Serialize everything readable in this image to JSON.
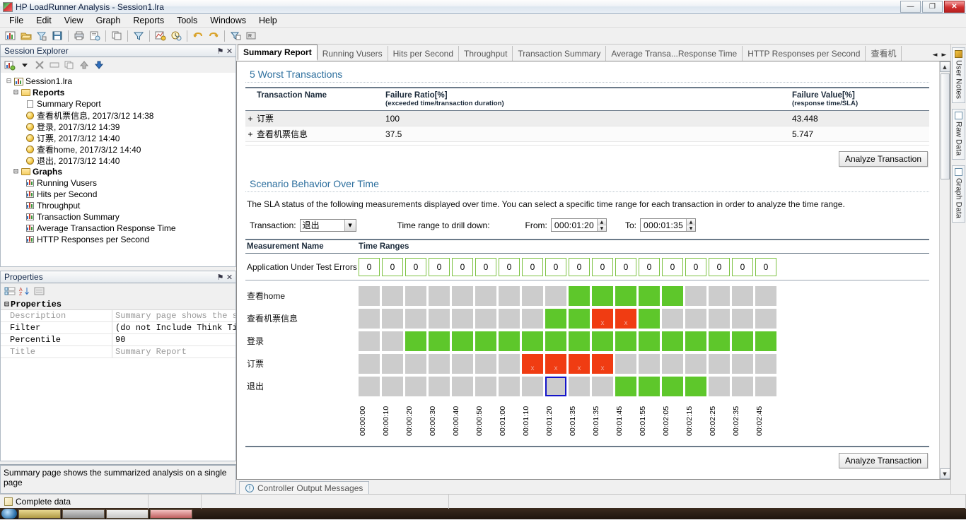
{
  "window": {
    "title": "HP LoadRunner Analysis - Session1.lra",
    "minimize_label": "—",
    "restore_label": "❐",
    "close_label": "✕"
  },
  "menubar": {
    "items": [
      "File",
      "Edit",
      "View",
      "Graph",
      "Reports",
      "Tools",
      "Windows",
      "Help"
    ]
  },
  "toolbar": {
    "buttons": [
      "new-analysis-icon",
      "open-session-icon",
      "set-filter-icon",
      "save-icon",
      "print-icon",
      "report-icon",
      "copy-graph-icon",
      "filter-icon",
      "merge-graphs-icon",
      "auto-correlate-icon",
      "undo-icon",
      "redo-icon",
      "crossresult-icon",
      "raw-data-icon"
    ]
  },
  "session_explorer": {
    "title": "Session Explorer",
    "pin_label": "⚑",
    "close_label": "✕",
    "toolbar": [
      "add-graph-icon",
      "dropdown-icon",
      "delete-icon",
      "rename-icon",
      "duplicate-icon",
      "move-up-icon",
      "move-down-icon"
    ],
    "root": "Session1.lra",
    "groups": [
      {
        "label": "Reports",
        "items": [
          {
            "label": "Summary Report",
            "icon": "document-icon"
          },
          {
            "label": "查看机票信息, 2017/3/12 14:38",
            "icon": "clock-icon"
          },
          {
            "label": "登录, 2017/3/12 14:39",
            "icon": "clock-icon"
          },
          {
            "label": "订票, 2017/3/12 14:40",
            "icon": "clock-icon"
          },
          {
            "label": "查看home, 2017/3/12 14:40",
            "icon": "clock-icon"
          },
          {
            "label": "退出, 2017/3/12 14:40",
            "icon": "clock-icon"
          }
        ]
      },
      {
        "label": "Graphs",
        "items": [
          {
            "label": "Running Vusers",
            "icon": "chart-icon"
          },
          {
            "label": "Hits per Second",
            "icon": "chart-icon"
          },
          {
            "label": "Throughput",
            "icon": "chart-icon"
          },
          {
            "label": "Transaction Summary",
            "icon": "chart-icon"
          },
          {
            "label": "Average Transaction Response Time",
            "icon": "chart-icon"
          },
          {
            "label": "HTTP Responses per Second",
            "icon": "chart-icon"
          }
        ]
      }
    ]
  },
  "properties_panel": {
    "title": "Properties",
    "pin_label": "⚑",
    "close_label": "✕",
    "toolbar": [
      "categorized-icon",
      "sort-alpha-icon",
      "property-pages-icon"
    ],
    "group_label": "Properties",
    "group_twist": "⊟",
    "rows": [
      {
        "key": "Description",
        "value": "Summary page shows the summa",
        "dim": true
      },
      {
        "key": "Filter",
        "value": "(do not Include Think Time)",
        "dim": false
      },
      {
        "key": "Percentile",
        "value": "90",
        "dim": false
      },
      {
        "key": "Title",
        "value": "Summary Report",
        "dim": true
      }
    ],
    "description_text": "Summary page shows the summarized analysis on a single page"
  },
  "tabs": {
    "items": [
      {
        "label": "Summary Report",
        "active": true
      },
      {
        "label": "Running Vusers",
        "active": false
      },
      {
        "label": "Hits per Second",
        "active": false
      },
      {
        "label": "Throughput",
        "active": false
      },
      {
        "label": "Transaction Summary",
        "active": false
      },
      {
        "label": "Average Transa...Response Time",
        "active": false
      },
      {
        "label": "HTTP Responses per Second",
        "active": false
      },
      {
        "label": "查看机",
        "active": false
      }
    ],
    "nav_prev": "◄",
    "nav_next": "►"
  },
  "report": {
    "worst_transactions": {
      "title": "5 Worst Transactions",
      "columns": {
        "expander": "+",
        "name": "Transaction Name",
        "ratio_main": "Failure Ratio[%]",
        "ratio_sub": "(exceeded time/transaction duration)",
        "value_main": "Failure Value[%]",
        "value_sub": "(response time/SLA)"
      },
      "rows": [
        {
          "expander": "+",
          "name": "订票",
          "failure_ratio": "100",
          "failure_value": "43.448"
        },
        {
          "expander": "+",
          "name": "查看机票信息",
          "failure_ratio": "37.5",
          "failure_value": "5.747"
        }
      ],
      "analyze_button": "Analyze Transaction"
    },
    "scenario_behavior": {
      "title": "Scenario Behavior Over Time",
      "description": "The SLA status of the following measurements displayed over time. You can select a specific time range for each transaction in order to analyze the time range.",
      "transaction_label": "Transaction:",
      "transaction_value": "退出",
      "time_range_label": "Time range to drill down:",
      "from_label": "From:",
      "from_value": "000:01:20",
      "to_label": "To:",
      "to_value": "000:01:35",
      "spin_up": "▲",
      "spin_down": "▼",
      "analyze_button": "Analyze Transaction"
    },
    "measurement_grid": {
      "col_name": "Measurement Name",
      "col_ranges": "Time Ranges",
      "errors_row": {
        "label": "Application Under Test Errors",
        "values": [
          "0",
          "0",
          "0",
          "0",
          "0",
          "0",
          "0",
          "0",
          "0",
          "0",
          "0",
          "0",
          "0",
          "0",
          "0",
          "0",
          "0",
          "0"
        ]
      },
      "rows": [
        {
          "label": "查看home",
          "states": [
            "gray",
            "gray",
            "gray",
            "gray",
            "gray",
            "gray",
            "gray",
            "gray",
            "gray",
            "green",
            "green",
            "green",
            "green",
            "green",
            "gray",
            "gray",
            "gray",
            "gray"
          ]
        },
        {
          "label": "查看机票信息",
          "states": [
            "gray",
            "gray",
            "gray",
            "gray",
            "gray",
            "gray",
            "gray",
            "gray",
            "green",
            "green",
            "red",
            "red",
            "green",
            "gray",
            "gray",
            "gray",
            "gray",
            "gray"
          ]
        },
        {
          "label": "登录",
          "states": [
            "gray",
            "gray",
            "green",
            "green",
            "green",
            "green",
            "green",
            "green",
            "green",
            "green",
            "green",
            "green",
            "green",
            "green",
            "green",
            "green",
            "green",
            "green"
          ]
        },
        {
          "label": "订票",
          "states": [
            "gray",
            "gray",
            "gray",
            "gray",
            "gray",
            "gray",
            "gray",
            "red",
            "red",
            "red",
            "red",
            "gray",
            "gray",
            "gray",
            "gray",
            "gray",
            "gray",
            "gray"
          ]
        },
        {
          "label": "退出",
          "states": [
            "gray",
            "gray",
            "gray",
            "gray",
            "gray",
            "gray",
            "gray",
            "gray",
            "selected",
            "gray",
            "gray",
            "green",
            "green",
            "green",
            "green",
            "gray",
            "gray",
            "gray"
          ]
        }
      ],
      "fail_marker": "x",
      "time_labels": [
        "00:00:00",
        "00:00:10",
        "00:00:20",
        "00:00:30",
        "00:00:40",
        "00:00:50",
        "00:01:00",
        "00:01:10",
        "00:01:20",
        "00:01:35",
        "00:01:35",
        "00:01:45",
        "00:01:55",
        "00:02:05",
        "00:02:15",
        "00:02:25",
        "00:02:35",
        "00:02:45"
      ]
    }
  },
  "right_strip": {
    "tabs": [
      {
        "label": "User Notes",
        "icon": "notes-icon"
      },
      {
        "label": "Raw Data",
        "icon": "raw-data-icon"
      },
      {
        "label": "Graph Data",
        "icon": "graph-data-icon"
      }
    ]
  },
  "bottom": {
    "output_tab": "Controller Output Messages",
    "output_tab_icon": "info-icon",
    "status_text": "Complete data"
  },
  "colors": {
    "sla_pass": "#5ec72b",
    "sla_fail": "#f03c12",
    "sla_none": "#cccccc",
    "selection": "#1414c8",
    "section_title": "#2d6f9e"
  },
  "scrollbar": {
    "up": "▲",
    "down": "▼"
  }
}
